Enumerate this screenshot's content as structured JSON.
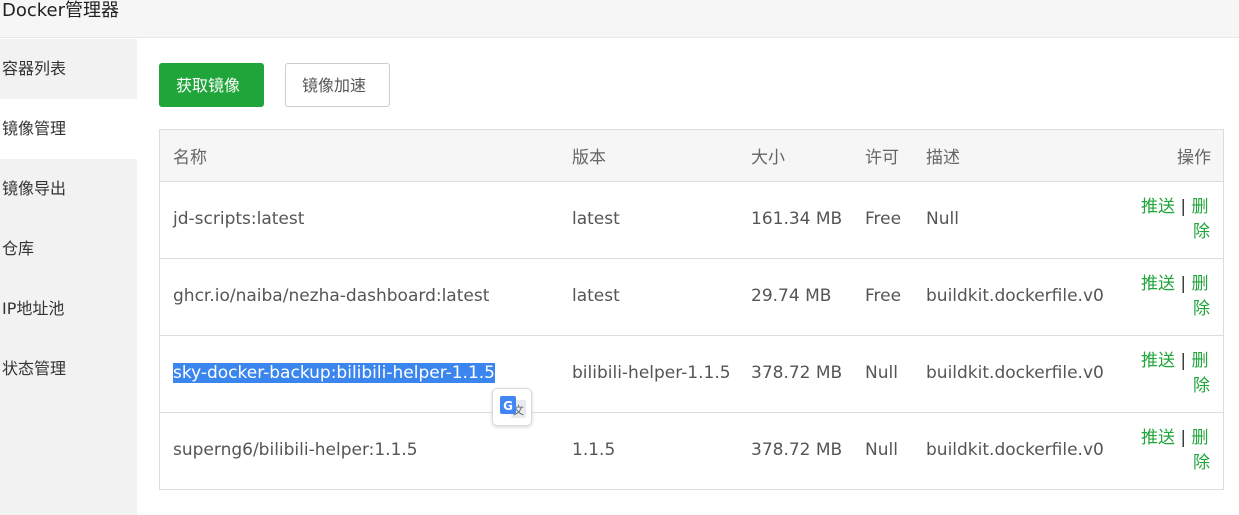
{
  "app": {
    "title": "Docker管理器"
  },
  "sidebar": {
    "items": [
      {
        "label": "容器列表",
        "active": false
      },
      {
        "label": "镜像管理",
        "active": true
      },
      {
        "label": "镜像导出",
        "active": false
      },
      {
        "label": "仓库",
        "active": false
      },
      {
        "label": "IP地址池",
        "active": false
      },
      {
        "label": "状态管理",
        "active": false
      }
    ]
  },
  "toolbar": {
    "get_image_label": "获取镜像",
    "accelerate_label": "镜像加速"
  },
  "table": {
    "headers": {
      "name": "名称",
      "version": "版本",
      "size": "大小",
      "license": "许可",
      "description": "描述",
      "operations": "操作"
    },
    "rows": [
      {
        "name": "jd-scripts:latest",
        "version": "latest",
        "size": "161.34 MB",
        "license": "Free",
        "description": "Null",
        "selected": false
      },
      {
        "name": "ghcr.io/naiba/nezha-dashboard:latest",
        "version": "latest",
        "size": "29.74 MB",
        "license": "Free",
        "description": "buildkit.dockerfile.v0",
        "selected": false
      },
      {
        "name": "sky-docker-backup:bilibili-helper-1.1.5",
        "version": "bilibili-helper-1.1.5",
        "size": "378.72 MB",
        "license": "Null",
        "description": "buildkit.dockerfile.v0",
        "selected": true
      },
      {
        "name": "superng6/bilibili-helper:1.1.5",
        "version": "1.1.5",
        "size": "378.72 MB",
        "license": "Null",
        "description": "buildkit.dockerfile.v0",
        "selected": false
      }
    ],
    "ops": {
      "push": "推送",
      "separator": "|",
      "delete_line1": "删",
      "delete_line2": "除"
    }
  },
  "overlay": {
    "icon": "google-translate-icon"
  },
  "colors": {
    "accent": "#20a53a",
    "selection": "#3b86ee"
  }
}
